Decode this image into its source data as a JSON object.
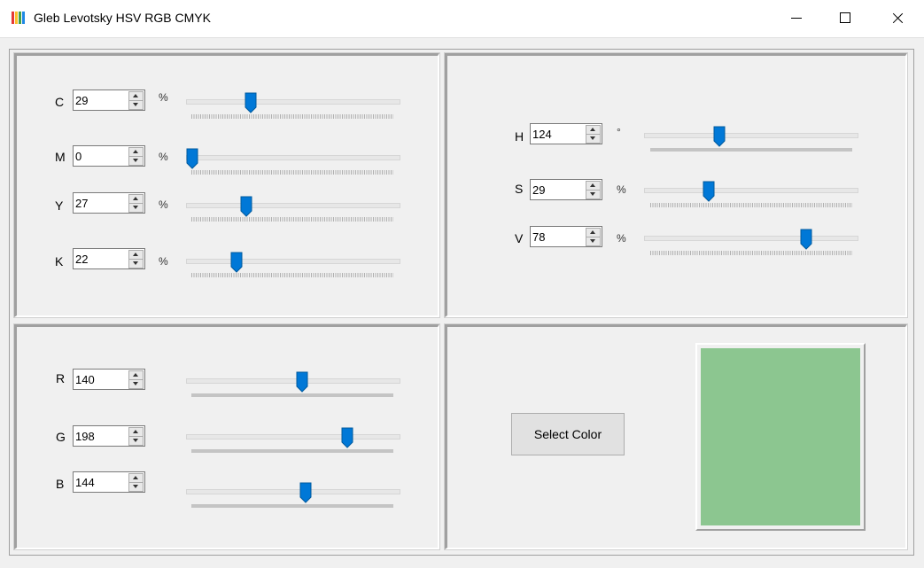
{
  "window": {
    "title": "Gleb Levotsky HSV RGB CMYK",
    "icon": "color-bars-icon",
    "icon_colors": [
      "#e53935",
      "#fbc02d",
      "#43a047",
      "#1e88e5"
    ]
  },
  "cmyk": {
    "c": {
      "label": "C",
      "value": "29",
      "unit": "%",
      "level": 29,
      "max": 100
    },
    "m": {
      "label": "M",
      "value": "0",
      "unit": "%",
      "level": 0,
      "max": 100
    },
    "y": {
      "label": "Y",
      "value": "27",
      "unit": "%",
      "level": 27,
      "max": 100
    },
    "k": {
      "label": "K",
      "value": "22",
      "unit": "%",
      "level": 22,
      "max": 100
    }
  },
  "hsv": {
    "h": {
      "label": "H",
      "value": "124",
      "unit": "°",
      "level": 124,
      "max": 360
    },
    "s": {
      "label": "S",
      "value": "29",
      "unit": "%",
      "level": 29,
      "max": 100
    },
    "v": {
      "label": "V",
      "value": "78",
      "unit": "%",
      "level": 78,
      "max": 100
    }
  },
  "rgb": {
    "r": {
      "label": "R",
      "value": "140",
      "level": 140,
      "max": 255
    },
    "g": {
      "label": "G",
      "value": "198",
      "level": 198,
      "max": 255
    },
    "b": {
      "label": "B",
      "value": "144",
      "level": 144,
      "max": 255
    }
  },
  "select_color_label": "Select Color",
  "preview_color": "#8cc690",
  "accent_color": "#0078d7"
}
